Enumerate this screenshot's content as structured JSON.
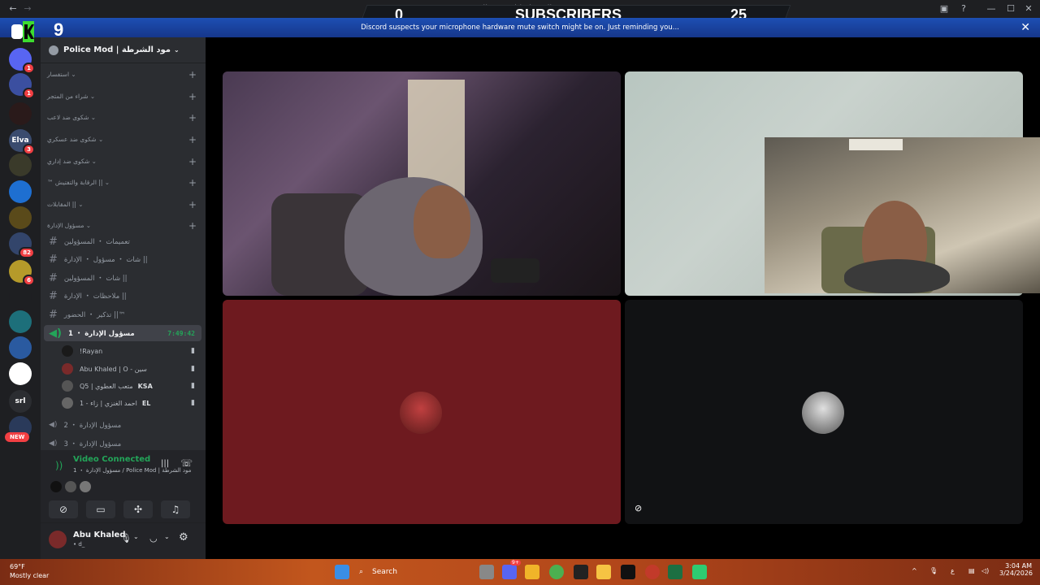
{
  "window": {
    "title": "Police Mod | مود الشرطة",
    "back": "←",
    "forward": "→"
  },
  "stream_overlay": {
    "left_count": "0",
    "label": "SUBSCRIBERS",
    "right_count": "25",
    "logo_number": "9"
  },
  "notice": {
    "text": "Discord suspects your microphone hardware mute switch might be on. Just reminding you...",
    "close": "✕"
  },
  "servers": {
    "new_badge": "NEW",
    "items": [
      {
        "label": "",
        "badge": "1",
        "color": "#5865f2"
      },
      {
        "label": "",
        "badge": "1",
        "color": "#3b4fa0"
      },
      {
        "label": "",
        "badge": "",
        "color": "#2a1a1a"
      },
      {
        "label": "Elva",
        "badge": "3",
        "color": "#3a4b6e"
      },
      {
        "label": "",
        "badge": "",
        "color": "#3a3a2a"
      },
      {
        "label": "",
        "badge": "",
        "color": "#1e6fd1"
      },
      {
        "label": "",
        "badge": "",
        "color": "#5a4a1a"
      },
      {
        "label": "",
        "badge": "82",
        "color": "#33456b"
      },
      {
        "label": "",
        "badge": "6",
        "color": "#b59a2a"
      },
      {
        "label": "",
        "badge": "",
        "color": "#1e1f22"
      },
      {
        "label": "",
        "badge": "",
        "color": "#1d6f7a"
      },
      {
        "label": "",
        "badge": "",
        "color": "#2a5aa0"
      },
      {
        "label": "",
        "badge": "",
        "color": "#ffffff"
      },
      {
        "label": "srl",
        "badge": "",
        "color": "#2b2d31"
      },
      {
        "label": "",
        "badge": "",
        "color": "#2a3a5a"
      }
    ]
  },
  "guild": {
    "name": "Police Mod | مود الشرطة"
  },
  "categories": [
    {
      "label": "استفسار"
    },
    {
      "label": "شراء من المتجر"
    },
    {
      "label": "شكوى ضد لاعب"
    },
    {
      "label": "شكوى ضد عسكري"
    },
    {
      "label": "شكوى ضد إداري"
    },
    {
      "label": "™ الرقابة والتفتيش ||"
    },
    {
      "label": "المقابلات ||"
    },
    {
      "label": "مسؤول الإدارة"
    }
  ],
  "channels": [
    {
      "label": "تعميمات ・ المسؤولين"
    },
    {
      "label": "شات ・ مسؤول ・ الإدارة ||"
    },
    {
      "label": "شات ・ المسؤولين ||"
    },
    {
      "label": "ملاحظات ・ الإدارة ||"
    },
    {
      "label": "تذكير ・ الحضور ||™"
    }
  ],
  "voice_active": {
    "label": "مسؤول الإدارة ・ 1",
    "timer": "7:49:42"
  },
  "members": [
    {
      "name": "!Rayan",
      "tag": ""
    },
    {
      "name": "Abu Khaled | O - سين",
      "tag": ""
    },
    {
      "name": "Q5 | متعب العطوي",
      "tag": "KSA"
    },
    {
      "name": "احمد الغنزي | زاء - 1",
      "tag": "EL"
    }
  ],
  "voice_others": [
    {
      "label": "مسؤول الإدارة ・ 2"
    },
    {
      "label": "مسؤول الإدارة ・ 3"
    }
  ],
  "voice_panel": {
    "status": "Video Connected",
    "channel": "مسؤول الإدارة ・ 1 / Police Mod | مود الشرطة"
  },
  "user": {
    "name": "Abu Khaled",
    "status": "• d_"
  },
  "taskbar": {
    "weather_temp": "69°F",
    "weather_desc": "Mostly clear",
    "search": "Search",
    "time": "3:04 AM",
    "date": "3/24/2026",
    "lang": "ع",
    "discord_badge": "9+"
  }
}
